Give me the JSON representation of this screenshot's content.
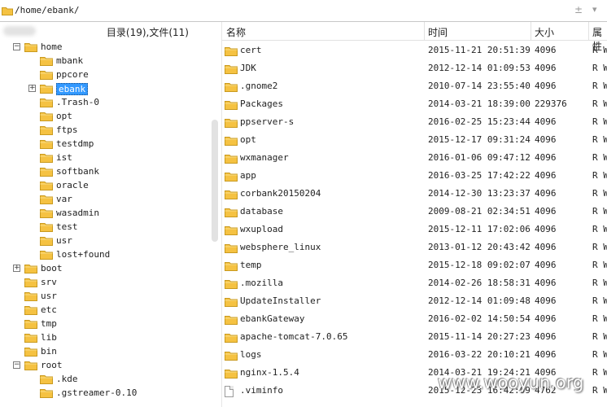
{
  "path_bar": {
    "path": "/home/ebank/",
    "plus_minus": "±",
    "dropdown": "▾"
  },
  "left_panel": {
    "header": "目录(19),文件(11)",
    "tree": [
      {
        "label": "home",
        "depth": 1,
        "toggle": "−"
      },
      {
        "label": "mbank",
        "depth": 2,
        "toggle": ""
      },
      {
        "label": "ppcore",
        "depth": 2,
        "toggle": ""
      },
      {
        "label": "ebank",
        "depth": 2,
        "toggle": "+",
        "selected": true
      },
      {
        "label": ".Trash-0",
        "depth": 2,
        "toggle": ""
      },
      {
        "label": "opt",
        "depth": 2,
        "toggle": ""
      },
      {
        "label": "ftps",
        "depth": 2,
        "toggle": ""
      },
      {
        "label": "testdmp",
        "depth": 2,
        "toggle": ""
      },
      {
        "label": "ist",
        "depth": 2,
        "toggle": ""
      },
      {
        "label": "softbank",
        "depth": 2,
        "toggle": ""
      },
      {
        "label": "oracle",
        "depth": 2,
        "toggle": ""
      },
      {
        "label": "var",
        "depth": 2,
        "toggle": ""
      },
      {
        "label": "wasadmin",
        "depth": 2,
        "toggle": ""
      },
      {
        "label": "test",
        "depth": 2,
        "toggle": ""
      },
      {
        "label": "usr",
        "depth": 2,
        "toggle": ""
      },
      {
        "label": "lost+found",
        "depth": 2,
        "toggle": ""
      },
      {
        "label": "boot",
        "depth": 1,
        "toggle": "+"
      },
      {
        "label": "srv",
        "depth": 1,
        "toggle": ""
      },
      {
        "label": "usr",
        "depth": 1,
        "toggle": ""
      },
      {
        "label": "etc",
        "depth": 1,
        "toggle": ""
      },
      {
        "label": "tmp",
        "depth": 1,
        "toggle": ""
      },
      {
        "label": "lib",
        "depth": 1,
        "toggle": ""
      },
      {
        "label": "bin",
        "depth": 1,
        "toggle": ""
      },
      {
        "label": "root",
        "depth": 1,
        "toggle": "−"
      },
      {
        "label": ".kde",
        "depth": 2,
        "toggle": ""
      },
      {
        "label": ".gstreamer-0.10",
        "depth": 2,
        "toggle": ""
      }
    ]
  },
  "columns": {
    "name": "名称",
    "time": "时间",
    "size": "大小",
    "attr": "属性"
  },
  "files": [
    {
      "name": "cert",
      "time": "2015-11-21 20:51:39",
      "size": "4096",
      "attr": "R W",
      "type": "folder"
    },
    {
      "name": "JDK",
      "time": "2012-12-14 01:09:53",
      "size": "4096",
      "attr": "R W",
      "type": "folder"
    },
    {
      "name": ".gnome2",
      "time": "2010-07-14 23:55:40",
      "size": "4096",
      "attr": "R W",
      "type": "folder"
    },
    {
      "name": "Packages",
      "time": "2014-03-21 18:39:00",
      "size": "229376",
      "attr": "R W",
      "type": "folder"
    },
    {
      "name": "ppserver-s",
      "time": "2016-02-25 15:23:44",
      "size": "4096",
      "attr": "R W",
      "type": "folder"
    },
    {
      "name": "opt",
      "time": "2015-12-17 09:31:24",
      "size": "4096",
      "attr": "R W",
      "type": "folder"
    },
    {
      "name": "wxmanager",
      "time": "2016-01-06 09:47:12",
      "size": "4096",
      "attr": "R W",
      "type": "folder"
    },
    {
      "name": "app",
      "time": "2016-03-25 17:42:22",
      "size": "4096",
      "attr": "R W",
      "type": "folder"
    },
    {
      "name": "corbank20150204",
      "time": "2014-12-30 13:23:37",
      "size": "4096",
      "attr": "R W",
      "type": "folder"
    },
    {
      "name": "database",
      "time": "2009-08-21 02:34:51",
      "size": "4096",
      "attr": "R W",
      "type": "folder"
    },
    {
      "name": "wxupload",
      "time": "2015-12-11 17:02:06",
      "size": "4096",
      "attr": "R W",
      "type": "folder"
    },
    {
      "name": "websphere_linux",
      "time": "2013-01-12 20:43:42",
      "size": "4096",
      "attr": "R W",
      "type": "folder"
    },
    {
      "name": "temp",
      "time": "2015-12-18 09:02:07",
      "size": "4096",
      "attr": "R W",
      "type": "folder"
    },
    {
      "name": ".mozilla",
      "time": "2014-02-26 18:58:31",
      "size": "4096",
      "attr": "R W",
      "type": "folder"
    },
    {
      "name": "UpdateInstaller",
      "time": "2012-12-14 01:09:48",
      "size": "4096",
      "attr": "R W",
      "type": "folder"
    },
    {
      "name": "ebankGateway",
      "time": "2016-02-02 14:50:54",
      "size": "4096",
      "attr": "R W",
      "type": "folder"
    },
    {
      "name": "apache-tomcat-7.0.65",
      "time": "2015-11-14 20:27:23",
      "size": "4096",
      "attr": "R W",
      "type": "folder"
    },
    {
      "name": "logs",
      "time": "2016-03-22 20:10:21",
      "size": "4096",
      "attr": "R W",
      "type": "folder"
    },
    {
      "name": "nginx-1.5.4",
      "time": "2014-03-21 19:24:21",
      "size": "4096",
      "attr": "R W",
      "type": "folder"
    },
    {
      "name": ".viminfo",
      "time": "2015-12-23 16:42:09",
      "size": "4762",
      "attr": "R W",
      "type": "file"
    }
  ],
  "watermark": "www.wooyun.org",
  "colors": {
    "folder": "#f5c242",
    "folder_edge": "#c99a1f",
    "selection": "#3399ff"
  }
}
